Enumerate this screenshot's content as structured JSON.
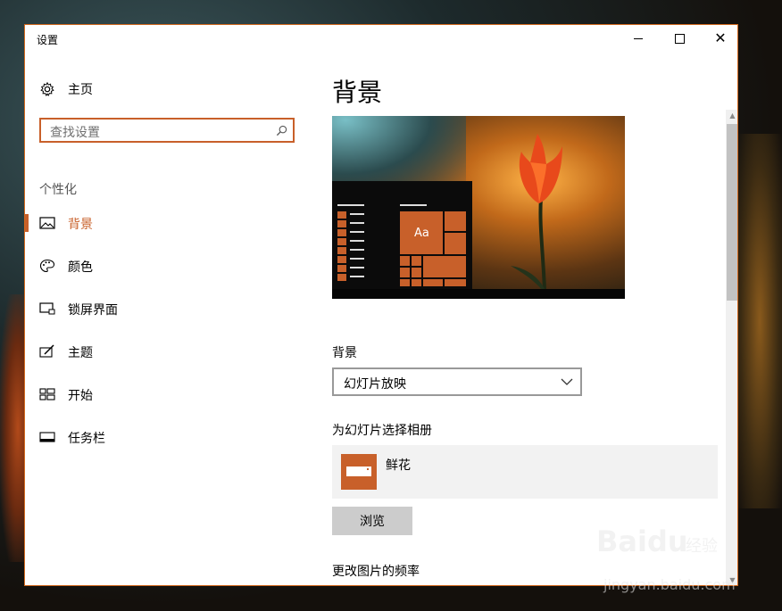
{
  "window": {
    "title": "设置"
  },
  "sidebar": {
    "home_label": "主页",
    "search_placeholder": "查找设置",
    "section_heading": "个性化",
    "items": [
      {
        "label": "背景",
        "icon": "picture-icon",
        "active": true
      },
      {
        "label": "颜色",
        "icon": "palette-icon",
        "active": false
      },
      {
        "label": "锁屏界面",
        "icon": "lock-screen-icon",
        "active": false
      },
      {
        "label": "主题",
        "icon": "theme-brush-icon",
        "active": false
      },
      {
        "label": "开始",
        "icon": "start-grid-icon",
        "active": false
      },
      {
        "label": "任务栏",
        "icon": "taskbar-icon",
        "active": false
      }
    ]
  },
  "main": {
    "page_title": "背景",
    "preview": {
      "tile_text": "Aa"
    },
    "background_label": "背景",
    "background_value": "幻灯片放映",
    "album_label": "为幻灯片选择相册",
    "album_name": "鲜花",
    "browse_label": "浏览",
    "frequency_label": "更改图片的频率"
  },
  "colors": {
    "accent": "#c8602a"
  },
  "watermark": {
    "brand": "Baidu",
    "sub": "经验",
    "url": "jingyan.baidu.com"
  }
}
